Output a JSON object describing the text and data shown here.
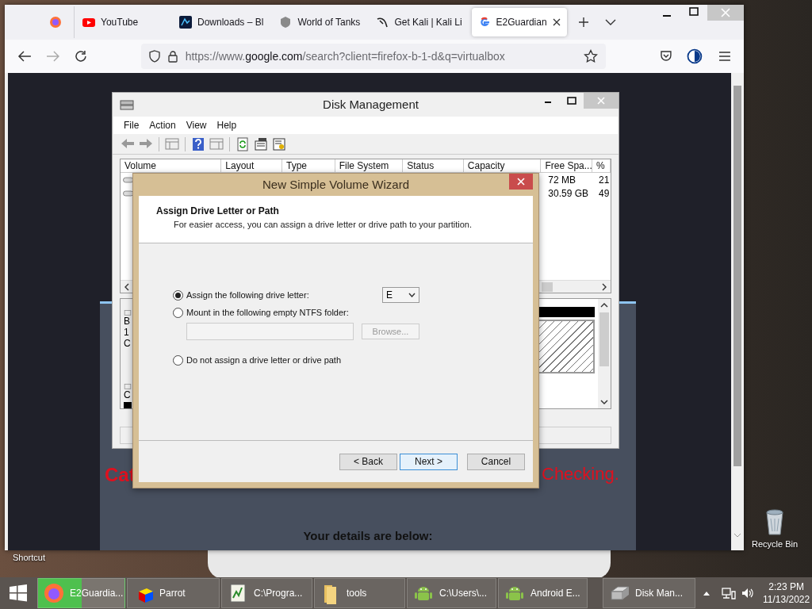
{
  "browser": {
    "tabs": [
      {
        "kind": "pinned",
        "selected": false
      },
      {
        "kind": "page",
        "label": "YouTube",
        "selected": false
      },
      {
        "kind": "page",
        "label": "Downloads – Bl",
        "selected": false
      },
      {
        "kind": "page",
        "label": "World of Tanks",
        "selected": false
      },
      {
        "kind": "page",
        "label": "Get Kali | Kali Li",
        "selected": false
      },
      {
        "kind": "page",
        "label": "E2Guardian",
        "selected": true
      }
    ],
    "url": {
      "prefix": "https://www.",
      "host": "google.com",
      "path": "/search?client=firefox-b-1-d&q=virtualbox"
    },
    "page": {
      "warning_left": "Cat",
      "warning_right": "Checking.",
      "details_heading": "Your details are below:"
    }
  },
  "disk_management": {
    "title": "Disk Management",
    "menu": [
      "File",
      "Action",
      "View",
      "Help"
    ],
    "columns": [
      "Volume",
      "Layout",
      "Type",
      "File System",
      "Status",
      "Capacity",
      "Free Spa...",
      "%"
    ],
    "rows": [
      {
        "free_space": "72 MB",
        "column_8": "21"
      },
      {
        "free_space": "30.59 GB",
        "column_8": "49"
      }
    ],
    "disk_0_fragments": [
      "B",
      "1",
      "C"
    ],
    "disk_1_fragments": [
      "C"
    ]
  },
  "wizard": {
    "title": "New Simple Volume Wizard",
    "heading": "Assign Drive Letter or Path",
    "subheading": "For easier access, you can assign a drive letter or drive path to your partition.",
    "options": [
      {
        "kind": "letter",
        "label": "Assign the following drive letter:",
        "selected": true
      },
      {
        "kind": "folder",
        "label": "Mount in the following empty NTFS folder:",
        "selected": false
      },
      {
        "kind": "none",
        "label": "Do not assign a drive letter or drive path",
        "selected": false
      }
    ],
    "drive_letter": "E",
    "folder_field": {
      "disabled": true
    },
    "browse": {
      "label": "Browse...",
      "disabled": true
    },
    "buttons": [
      {
        "label": "< Back",
        "default": false
      },
      {
        "label": "Next >",
        "default": true
      },
      {
        "label": "Cancel",
        "default": false
      }
    ]
  },
  "desktop": {
    "icons": [
      {
        "kind": "shortcut",
        "label": "Shortcut"
      },
      {
        "kind": "recycle",
        "label": "Recycle Bin"
      }
    ]
  },
  "taskbar": {
    "items": [
      {
        "label": "E2Guardia...",
        "selected": true
      },
      {
        "label": "Parrot",
        "selected": false
      },
      {
        "label": "C:\\Progra...",
        "selected": false
      },
      {
        "label": "tools",
        "selected": false
      },
      {
        "label": "C:\\Users\\...",
        "selected": false
      },
      {
        "label": "Android E...",
        "selected": false
      },
      {
        "label": "Disk Man...",
        "selected": false
      }
    ],
    "clock": {
      "time": "2:23 PM",
      "date": "11/13/2022"
    }
  }
}
